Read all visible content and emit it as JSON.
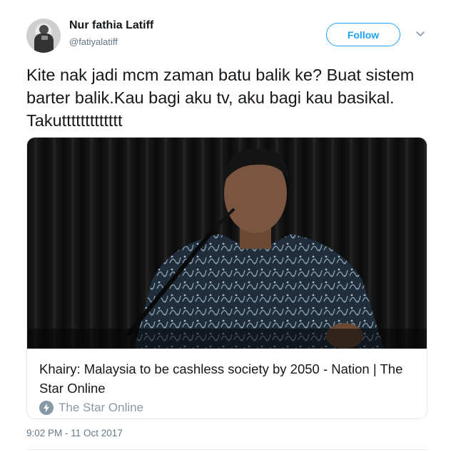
{
  "author": {
    "name": "Nur fathia Latiff",
    "handle": "@fatiyalatiff",
    "avatar_icon": "profile-photo"
  },
  "actions": {
    "follow_label": "Follow",
    "more_icon": "chevron-down-icon"
  },
  "tweet": {
    "text": "Kite nak jadi mcm zaman batu balik ke? Buat sistem barter balik.Kau bagi aku tv, aku bagi kau basikal. Takuttttttttttttt",
    "timestamp": "9:02 PM - 11 Oct 2017"
  },
  "card": {
    "title": "Khairy: Malaysia to be cashless society by 2050 - Nation | The Star Online",
    "source": "The Star Online",
    "source_icon": "lightning-bolt-icon"
  },
  "colors": {
    "accent": "#1da1f2",
    "text": "#14171a",
    "secondary": "#657786",
    "border": "#e1e8ed"
  }
}
